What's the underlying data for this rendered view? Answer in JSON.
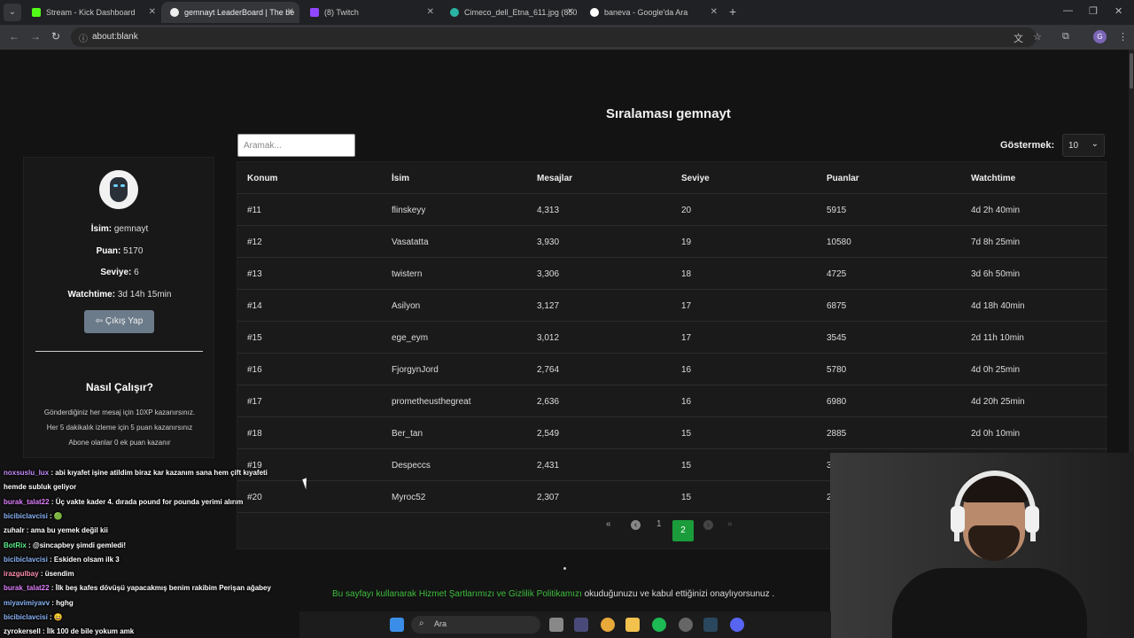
{
  "browser": {
    "tabs": [
      {
        "title": "Stream - Kick Dashboard",
        "color": "#53fc18"
      },
      {
        "title": "gemnayt LeaderBoard | The be",
        "color": "#eeeeee"
      },
      {
        "title": "(8) Twitch",
        "color": "#9146ff"
      },
      {
        "title": "Cimeco_dell_Etna_611.jpg (850",
        "color": "#2bb3a3"
      },
      {
        "title": "baneva - Google'da Ara",
        "color": "#ffffff"
      }
    ],
    "url": "about:blank",
    "profile_initial": "G"
  },
  "leaderboard": {
    "title": "Sıralaması gemnayt",
    "search_placeholder": "Aramak...",
    "show_label": "Göstermek:",
    "show_value": "10",
    "columns": [
      "Konum",
      "İsim",
      "Mesajlar",
      "Seviye",
      "Puanlar",
      "Watchtime"
    ],
    "rows": [
      [
        "#11",
        "flinskeyy",
        "4,313",
        "20",
        "5915",
        "4d 2h 40min"
      ],
      [
        "#12",
        "Vasatatta",
        "3,930",
        "19",
        "10580",
        "7d 8h 25min"
      ],
      [
        "#13",
        "twistern",
        "3,306",
        "18",
        "4725",
        "3d 6h 50min"
      ],
      [
        "#14",
        "Asilyon",
        "3,127",
        "17",
        "6875",
        "4d 18h 40min"
      ],
      [
        "#15",
        "ege_eym",
        "3,012",
        "17",
        "3545",
        "2d 11h 10min"
      ],
      [
        "#16",
        "FjorgynJord",
        "2,764",
        "16",
        "5780",
        "4d 0h 25min"
      ],
      [
        "#17",
        "prometheusthegreat",
        "2,636",
        "16",
        "6980",
        "4d 20h 25min"
      ],
      [
        "#18",
        "Ber_tan",
        "2,549",
        "15",
        "2885",
        "2d 0h 10min"
      ],
      [
        "#19",
        "Despeccs",
        "2,431",
        "15",
        "3",
        ""
      ],
      [
        "#20",
        "Myroc52",
        "2,307",
        "15",
        "2",
        ""
      ]
    ],
    "pagination": {
      "first": "«",
      "prev": "‹",
      "pages": [
        "1",
        "2"
      ],
      "current": "2",
      "next": "›",
      "last": "»"
    }
  },
  "profile": {
    "name_label": "İsim:",
    "name": "gemnayt",
    "points_label": "Puan:",
    "points": "5170",
    "level_label": "Seviye:",
    "level": "6",
    "watch_label": "Watchtime:",
    "watch": "3d 14h 15min",
    "logout": "Çıkış Yap",
    "how_title": "Nasıl Çalışır?",
    "how_lines": [
      "Gönderdiğiniz her mesaj için 10XP kazanırsınız.",
      "Her 5 dakikalık izleme için 5 puan kazanırsınız",
      "Abone olanlar 0 ek puan kazanır"
    ]
  },
  "footer": {
    "prefix": "Bu sayfayı kullanarak",
    "terms": "Hizmet Şartlarımızı",
    "and": "ve",
    "privacy": "Gizlilik Politikamızı",
    "suffix": "okuduğunuzu ve kabul ettiğinizi onaylıyorsunuz ."
  },
  "chat": [
    {
      "user": "noxsuslu_lux",
      "color": "#c58af9",
      "text": ": abi kıyafet işine atildim biraz kar kazanım sana hem çift kıyafeti"
    },
    {
      "user": "",
      "color": "#ffffff",
      "text": "hemde subluk geliyor"
    },
    {
      "user": "burak_talat22",
      "color": "#e080ff",
      "text": ": Üç vakte kader 4. dırada pound for pounda yerimi alırım"
    },
    {
      "user": "bicibiclavcisi",
      "color": "#8ab4f8",
      "text": ": 🟢"
    },
    {
      "user": "zuhalr",
      "color": "#ffffff",
      "text": ": ama bu yemek değil kii"
    },
    {
      "user": "BotRix",
      "color": "#5cf08c",
      "text": ": @sincapbey şimdi gemledi!"
    },
    {
      "user": "bicibiclavcisi",
      "color": "#8ab4f8",
      "text": ": Eskiden olsam ilk 3"
    },
    {
      "user": "irazgulbay",
      "color": "#ff8fb0",
      "text": ": üsendim"
    },
    {
      "user": "burak_talat22",
      "color": "#e080ff",
      "text": ": İlk beş kafes dövüşü yapacakmış benim rakibim Perişan ağabey"
    },
    {
      "user": "miyavimiyavv",
      "color": "#8ab4f8",
      "text": ": hghg"
    },
    {
      "user": "bicibiclavcisi",
      "color": "#8ab4f8",
      "text": ": 😄"
    },
    {
      "user": "zyrokersell",
      "color": "#ffffff",
      "text": ": İlk 100 de bile yokum amk"
    }
  ],
  "taskbar": {
    "search": "Ara"
  }
}
